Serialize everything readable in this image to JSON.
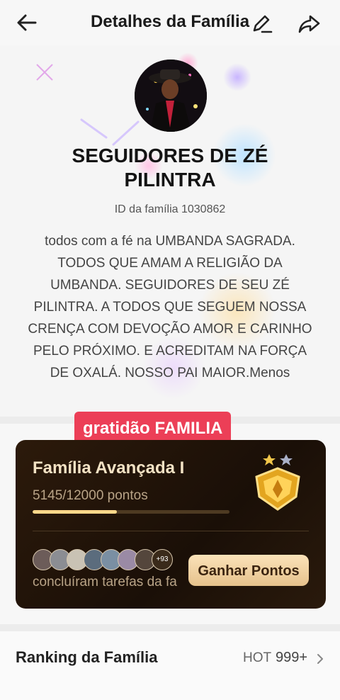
{
  "header": {
    "title": "Detalhes da Família",
    "back_icon": "arrow-left-icon",
    "edit_icon": "pencil-icon",
    "share_icon": "share-icon"
  },
  "family": {
    "name": "SEGUIDORES DE ZÉ PILINTRA",
    "id_label": "ID da família 1030862",
    "description": "todos com a fé na UMBANDA SAGRADA. TODOS QUE AMAM A RELIGIÃO DA UMBANDA.  SEGUIDORES DE SEU ZÉ PILINTRA. A TODOS QUE SEGUEM NOSSA CRENÇA COM DEVOÇÃO AMOR E CARINHO PELO PRÓXIMO. E ACREDITAM NA FORÇA DE OXALÁ. NOSSO PAI MAIOR.Menos"
  },
  "banner": {
    "text": "gratidão FAMILIA",
    "color": "#ec3f57"
  },
  "level_card": {
    "title": "Família Avançada I",
    "points": "5145/12000 pontos",
    "progress_fraction": 0.429,
    "more_members": "+93",
    "completed_text": "concluíram tarefas da fa",
    "earn_button": "Ganhar Pontos",
    "badge_icon": "gold-shield-badge-icon"
  },
  "ranking": {
    "title": "Ranking da Família",
    "hot_label": "HOT",
    "value": "999+",
    "chevron_icon": "chevron-right-icon"
  }
}
